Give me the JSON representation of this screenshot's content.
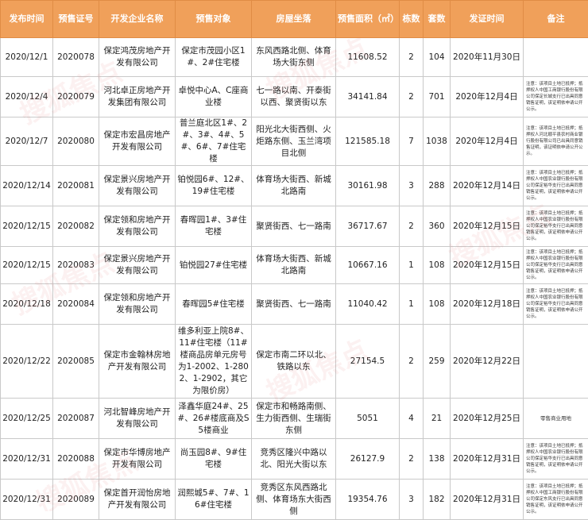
{
  "headers": [
    "发布时间",
    "预售证号",
    "开发企业名称",
    "预售对象",
    "房屋坐落",
    "预售面积（㎡）",
    "栋数",
    "套数",
    "发证时间",
    "备注"
  ],
  "rows": [
    {
      "date": "2020/12/1",
      "cert": "2020078",
      "company": "保定鸿茂房地产开发有限公司",
      "object": "保定市茂园小区1#、2#住宅楼",
      "location": "东风西路北侧、体育场大街东侧",
      "area": "11608.52",
      "buildings": "2",
      "units": "104",
      "issue": "2020年11月30日",
      "note": ""
    },
    {
      "date": "2020/12/4",
      "cert": "2020079",
      "company": "河北卓正房地产开发集团有限公司",
      "object": "卓悦中心A、C座商业楼",
      "location": "七一路以南、开泰街以西、聚贤街以东",
      "area": "34141.84",
      "buildings": "2",
      "units": "701",
      "issue": "2020年12月4日",
      "note": "注意：该项目土地已抵押；抵押权人中国工商银行股份有限公司保定长城支行已出具同意销售证明，该证明依申请公开公示。"
    },
    {
      "date": "2020/12/7",
      "cert": "2020080",
      "company": "保定市宏昌房地产开发有限公司",
      "object": "普兰庭北区1#、2#、3#、4#、5#、6#、7#住宅楼",
      "location": "阳光北大街西侧、火炬路东侧、玉兰湾项目北侧",
      "area": "121585.18",
      "buildings": "7",
      "units": "1038",
      "issue": "2020年12月4日",
      "note": "注意：该项目土地已抵押；抵押权人河北顺平县农村商业银行股份有限公司已出具同意销售证明，该证明依申请公开公示。"
    },
    {
      "date": "2020/12/14",
      "cert": "2020081",
      "company": "保定景兴房地产开发有限公司",
      "object": "铂悦园6#、12#、19#住宅楼",
      "location": "体育场大街西、新城北路南",
      "area": "30161.98",
      "buildings": "3",
      "units": "288",
      "issue": "2020年12月14日",
      "note": "注意：该项目土地已抵押；抵押权人中国农业银行股份有限公司保定裕华支行已出具同意销售证明，该证明依申请公开公示。"
    },
    {
      "date": "2020/12/15",
      "cert": "2020082",
      "company": "保定领和房地产开发有限公司",
      "object": "春晖园1#、3#住宅楼",
      "location": "聚贤街西、七一路南",
      "area": "36717.67",
      "buildings": "2",
      "units": "360",
      "issue": "2020年12月15日",
      "note": "注意：该项目土地已抵押；抵押权人中国农业银行股份有限公司保定裕华支行已出具同意销售证明，该证明依申请公开公示。"
    },
    {
      "date": "2020/12/15",
      "cert": "2020083",
      "company": "保定景兴房地产开发有限公司",
      "object": "铂悦园27#住宅楼",
      "location": "体育场大街西、新城北路南",
      "area": "10667.16",
      "buildings": "1",
      "units": "108",
      "issue": "2020年12月15日",
      "note": "注意：该项目土地已抵押；抵押权人中国农业银行股份有限公司保定裕华支行已出具同意销售证明，该证明依申请公开公示。"
    },
    {
      "date": "2020/12/18",
      "cert": "2020084",
      "company": "保定领和房地产开发有限公司",
      "object": "春晖园5#住宅楼",
      "location": "聚贤街西、七一路南",
      "area": "11040.42",
      "buildings": "1",
      "units": "108",
      "issue": "2020年12月18日",
      "note": "注意：该项目土地已抵押；抵押权人中国农业银行股份有限公司保定裕华支行已出具同意销售证明，该证明依申请公开公示。"
    },
    {
      "date": "2020/12/22",
      "cert": "2020085",
      "company": "保定市金翰林房地产开发有限公司",
      "object": "维多利亚上院8#、11#住宅楼（11#楼商品房单元房号为1-2002、1-2802、1-2902，其它为限价房）",
      "location": "保定市南二环以北、铁路以东",
      "area": "27154.5",
      "buildings": "2",
      "units": "259",
      "issue": "2020年12月22日",
      "note": ""
    },
    {
      "date": "2020/12/25",
      "cert": "2020087",
      "company": "河北智峰房地产开发有限公司",
      "object": "泽鑫华庭24#、25#、26#楼底商及S5楼商业",
      "location": "保定市和畅路南侧、生力街西侧、生瑞街东侧",
      "area": "5051",
      "buildings": "4",
      "units": "21",
      "issue": "2020年12月25日",
      "note": "零售商业用地"
    },
    {
      "date": "2020/12/31",
      "cert": "2020088",
      "company": "保定市华博房地产开发有限公司",
      "object": "尚玉园8#、9#住宅楼",
      "location": "竞秀区隆兴中路以北、阳光大街以东",
      "area": "26127.9",
      "buildings": "2",
      "units": "138",
      "issue": "2020年12月31日",
      "note": "注意：该项目土地已抵押；抵押权人中国农业银行股份有限公司保定裕华支行已出具同意销售证明，该证明依申请公开公示。"
    },
    {
      "date": "2020/12/31",
      "cert": "2020089",
      "company": "保定首开润怡房地产开发有限公司",
      "object": "润熙城5#、7#、16#住宅楼",
      "location": "竞秀区东风西路北侧、体育场东大街西侧",
      "area": "19354.76",
      "buildings": "3",
      "units": "182",
      "issue": "2020年12月31日",
      "note": "注意：该项目土地已抵押；抵押权人中国工商银行股份有限公司保定东风支行已出具同意销售证明，该证明依申请公开公示。"
    }
  ],
  "watermark": "搜狐焦点"
}
